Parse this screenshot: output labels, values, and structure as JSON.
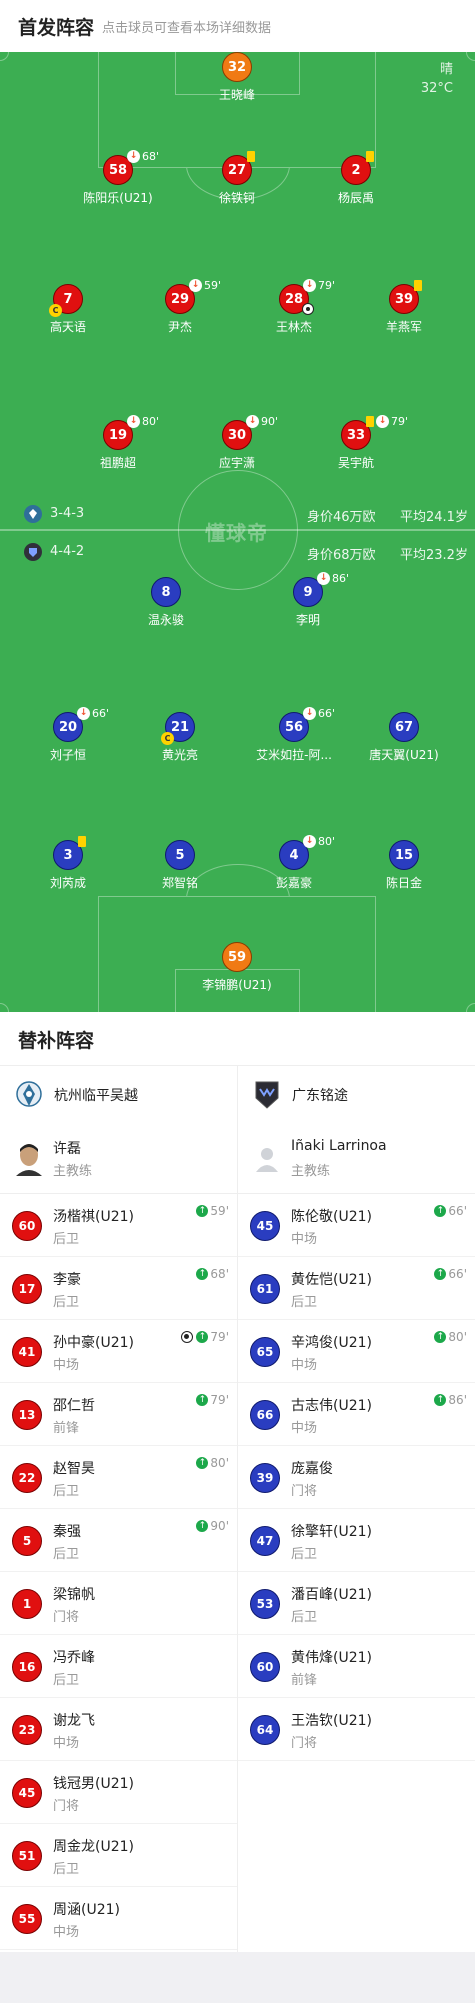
{
  "header": {
    "title": "首发阵容",
    "hint": "点击球员可查看本场详细数据"
  },
  "weather": {
    "condition": "晴",
    "temperature": "32°C"
  },
  "watermark": "懂球帝",
  "home_team": {
    "formation": "3-4-3",
    "value": "身价46万欧",
    "avg_age": "平均24.1岁",
    "color": "#e01010"
  },
  "away_team": {
    "formation": "4-4-2",
    "value": "身价68万欧",
    "avg_age": "平均23.2岁",
    "color": "#2a3dc0"
  },
  "home_starters": [
    {
      "num": "32",
      "name": "王晓峰",
      "color": "orange"
    },
    {
      "num": "58",
      "name": "陈阳乐(U21)",
      "sub_min": "68'"
    },
    {
      "num": "27",
      "name": "徐铁钶",
      "yellow": true
    },
    {
      "num": "2",
      "name": "杨辰禹",
      "yellow": true
    },
    {
      "num": "7",
      "name": "高天语",
      "captain": "C"
    },
    {
      "num": "29",
      "name": "尹杰",
      "sub_min": "59'"
    },
    {
      "num": "28",
      "name": "王林杰",
      "sub_min": "79'",
      "goal": true
    },
    {
      "num": "39",
      "name": "羊燕军",
      "yellow": true
    },
    {
      "num": "19",
      "name": "祖鹏超",
      "sub_min": "80'"
    },
    {
      "num": "30",
      "name": "应宇潇",
      "sub_min": "90'"
    },
    {
      "num": "33",
      "name": "吴宇航",
      "sub_min": "79'",
      "yellow": true
    }
  ],
  "away_starters": [
    {
      "num": "8",
      "name": "温永骏"
    },
    {
      "num": "9",
      "name": "李明",
      "sub_min": "86'"
    },
    {
      "num": "20",
      "name": "刘子恒",
      "sub_min": "66'"
    },
    {
      "num": "21",
      "name": "黄光亮",
      "captain": "C"
    },
    {
      "num": "56",
      "name": "艾米如拉-阿...",
      "sub_min": "66'"
    },
    {
      "num": "67",
      "name": "唐天翼(U21)"
    },
    {
      "num": "3",
      "name": "刘芮成",
      "yellow": true
    },
    {
      "num": "5",
      "name": "郑智铭"
    },
    {
      "num": "4",
      "name": "彭嘉豪",
      "sub_min": "80'"
    },
    {
      "num": "15",
      "name": "陈日金"
    },
    {
      "num": "59",
      "name": "李锦鹏(U21)",
      "color": "orange"
    }
  ],
  "subs": {
    "title": "替补阵容",
    "home": {
      "team_name": "杭州临平吴越",
      "coach": {
        "name": "许磊",
        "role": "主教练"
      },
      "players": [
        {
          "num": "60",
          "name": "汤楷祺(U21)",
          "pos": "后卫",
          "in": "59'"
        },
        {
          "num": "17",
          "name": "李豪",
          "pos": "后卫",
          "in": "68'"
        },
        {
          "num": "41",
          "name": "孙中豪(U21)",
          "pos": "中场",
          "in": "79'",
          "goal": true
        },
        {
          "num": "13",
          "name": "邵仁哲",
          "pos": "前锋",
          "in": "79'"
        },
        {
          "num": "22",
          "name": "赵智昊",
          "pos": "后卫",
          "in": "80'"
        },
        {
          "num": "5",
          "name": "秦强",
          "pos": "后卫",
          "in": "90'"
        },
        {
          "num": "1",
          "name": "梁锦帆",
          "pos": "门将"
        },
        {
          "num": "16",
          "name": "冯乔峰",
          "pos": "后卫"
        },
        {
          "num": "23",
          "name": "谢龙飞",
          "pos": "中场"
        },
        {
          "num": "45",
          "name": "钱冠男(U21)",
          "pos": "门将"
        },
        {
          "num": "51",
          "name": "周金龙(U21)",
          "pos": "后卫"
        },
        {
          "num": "55",
          "name": "周涵(U21)",
          "pos": "中场"
        }
      ]
    },
    "away": {
      "team_name": "广东铭途",
      "team_logo_text": "MINGTU",
      "coach": {
        "name": "Iñaki Larrinoa",
        "role": "主教练"
      },
      "players": [
        {
          "num": "45",
          "name": "陈伦敬(U21)",
          "pos": "中场",
          "in": "66'"
        },
        {
          "num": "61",
          "name": "黄佐恺(U21)",
          "pos": "后卫",
          "in": "66'"
        },
        {
          "num": "65",
          "name": "辛鸿俊(U21)",
          "pos": "中场",
          "in": "80'"
        },
        {
          "num": "66",
          "name": "古志伟(U21)",
          "pos": "中场",
          "in": "86'"
        },
        {
          "num": "39",
          "name": "庞嘉俊",
          "pos": "门将"
        },
        {
          "num": "47",
          "name": "徐擎轩(U21)",
          "pos": "后卫"
        },
        {
          "num": "53",
          "name": "潘百峰(U21)",
          "pos": "后卫"
        },
        {
          "num": "60",
          "name": "黄伟烽(U21)",
          "pos": "前锋"
        },
        {
          "num": "64",
          "name": "王浩钦(U21)",
          "pos": "门将"
        }
      ]
    }
  }
}
